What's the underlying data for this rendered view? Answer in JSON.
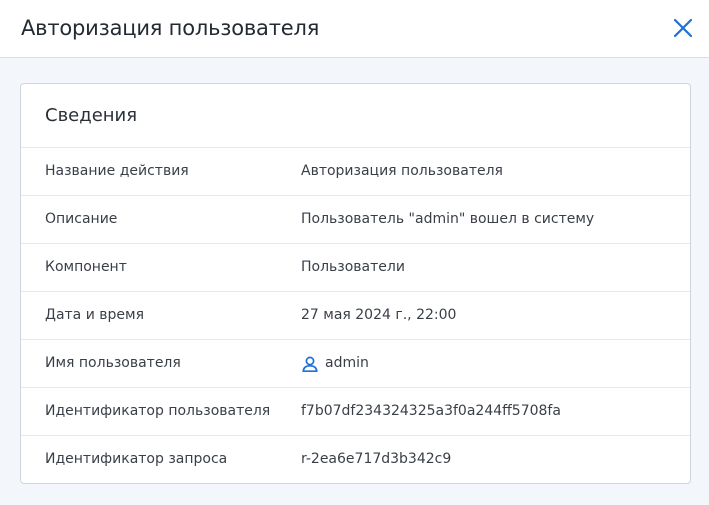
{
  "dialog": {
    "title": "Авторизация пользователя",
    "close_icon": "close-icon"
  },
  "card": {
    "title": "Сведения",
    "rows": [
      {
        "label": "Название действия",
        "value": "Авторизация пользователя"
      },
      {
        "label": "Описание",
        "value": "Пользователь \"admin\" вошел в систему"
      },
      {
        "label": "Компонент",
        "value": "Пользователи"
      },
      {
        "label": "Дата и время",
        "value": "27 мая 2024 г., 22:00"
      },
      {
        "label": "Имя пользователя",
        "value": "admin",
        "icon": "user-icon"
      },
      {
        "label": "Идентификатор пользователя",
        "value": "f7b07df234324325a3f0a244ff5708fa"
      },
      {
        "label": "Идентификатор запроса",
        "value": "r-2ea6e717d3b342c9"
      }
    ]
  },
  "colors": {
    "accent": "#1e6fd9",
    "background": "#f3f6fb",
    "card_border": "#cfd6e0"
  }
}
